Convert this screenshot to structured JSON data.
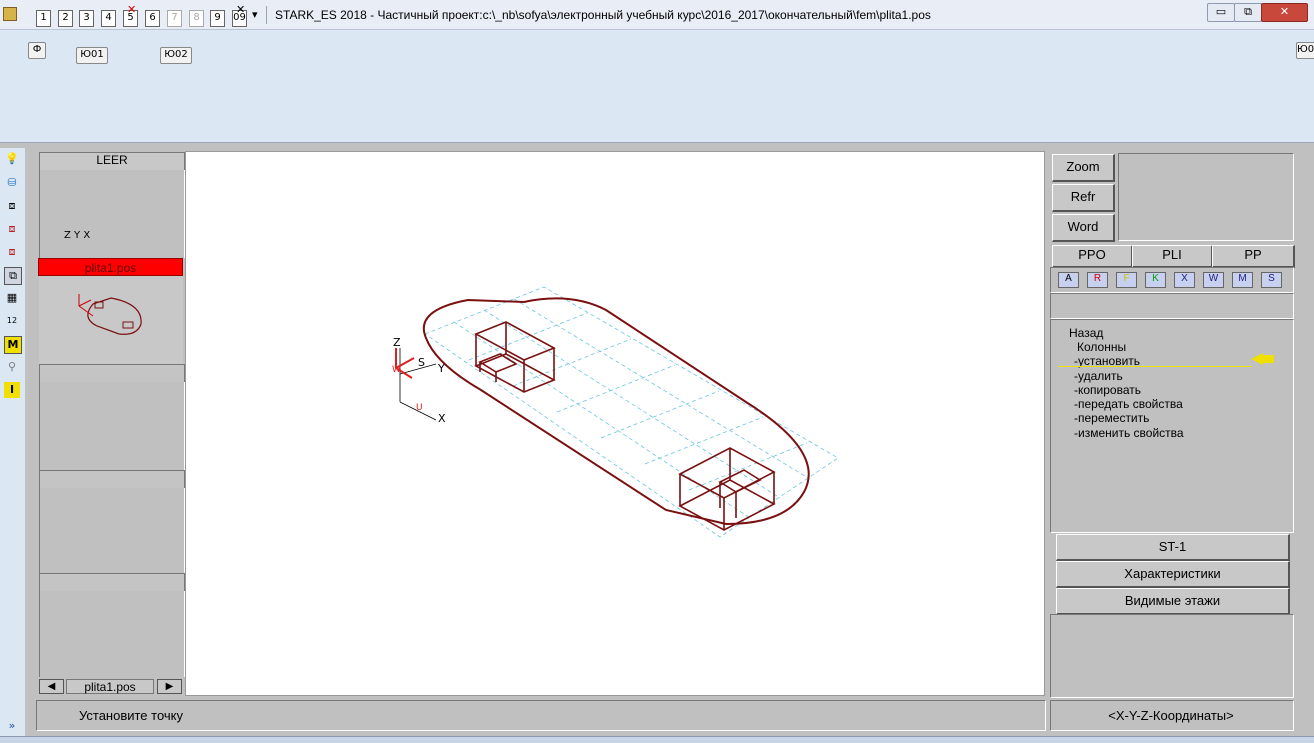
{
  "window": {
    "title": "STARK_ES 2018 - Частичный проект:c:\\_nb\\sofya\\электронный учебный курс\\2016_2017\\окончательный\\fem\\plita1.pos",
    "controls": {
      "minimize": "▭",
      "restore": "⧉",
      "close": "✕"
    }
  },
  "toolbar": {
    "buttons": [
      "1",
      "2",
      "3",
      "4",
      "5",
      "6",
      "7",
      "8",
      "9",
      "09"
    ],
    "chevron": "▾",
    "row2": {
      "phi": "Ф",
      "yu01": "Ю01",
      "yu02": "Ю02"
    },
    "right_edge": "Ю0"
  },
  "left_panel": {
    "header": "LEER",
    "file_label": "plita1.pos",
    "nav_label": "plita1.pos",
    "nav_prev": "◀",
    "nav_next": "▶",
    "expand": "»"
  },
  "canvas": {
    "axes_labels": {
      "z": "Z",
      "y": "Y",
      "x": "X",
      "s": "S",
      "w": "W",
      "u": "U"
    },
    "thumb_axes": "Z Y X",
    "colors": {
      "structure": "#7a1010",
      "grid": "#6cc6e0"
    }
  },
  "right_panel": {
    "zoom": "Zoom",
    "refr": "Refr",
    "word": "Word",
    "tabs": [
      "PPO",
      "PLI",
      "PP"
    ],
    "flags": [
      "A",
      "R",
      "F",
      "K",
      "X",
      "W",
      "M",
      "S"
    ],
    "menu": {
      "back": "Назад",
      "group": "Колонны",
      "items": [
        "-установить",
        "-удалить",
        "-копировать",
        "-передать свойства",
        "-переместить",
        "-изменить свойства"
      ],
      "active_index": 0
    },
    "st_button": "ST-1",
    "characteristics": "Характеристики",
    "visible_floors": "Видимые этажи"
  },
  "status": {
    "prompt": "Установите точку",
    "coords": "<X-Y-Z-Координаты>"
  }
}
